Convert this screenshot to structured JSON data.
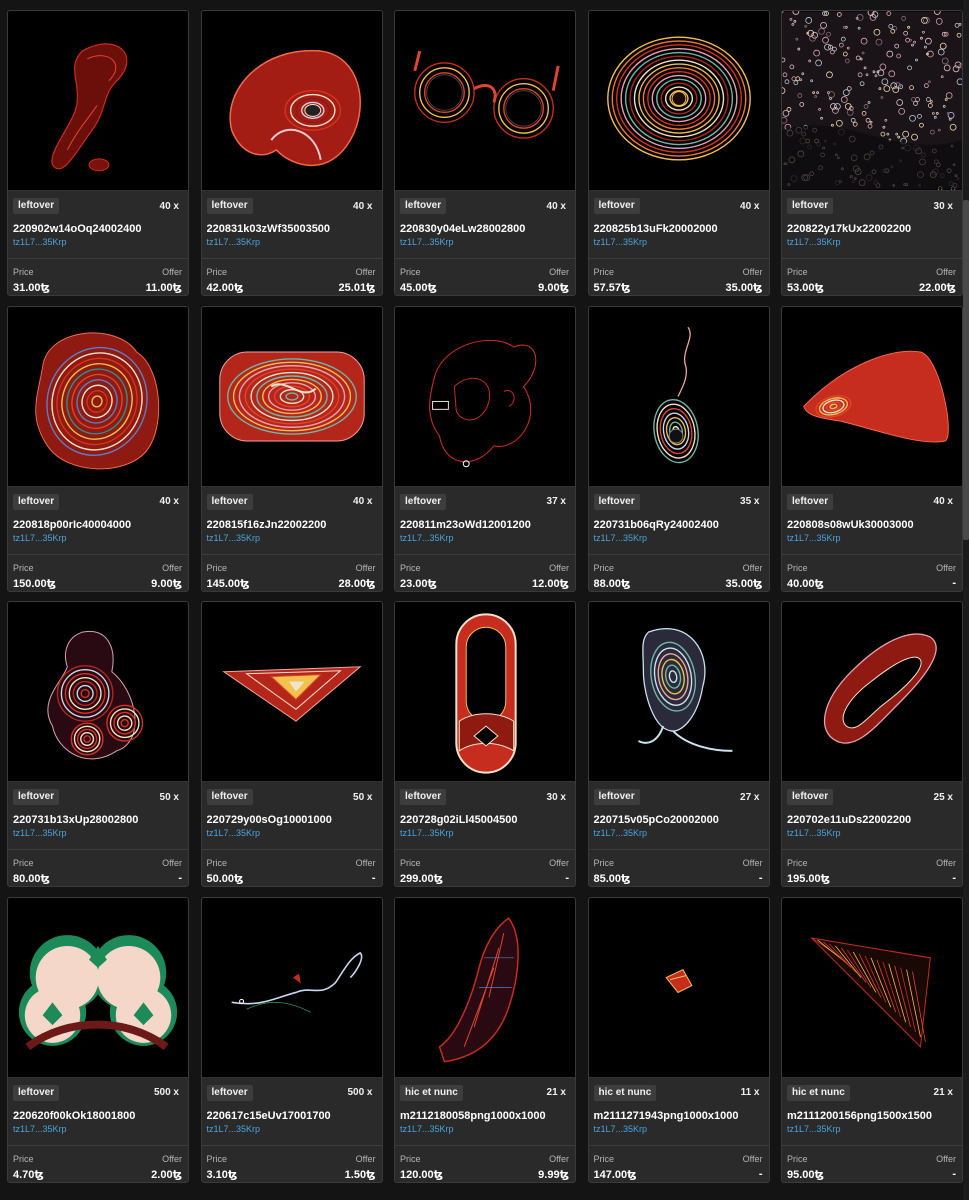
{
  "currency_symbol": "ꜩ",
  "labels": {
    "price": "Price",
    "offer": "Offer"
  },
  "colors": {
    "background": "#141414",
    "card": "#2a2a2a",
    "creator_link": "#4aa3df"
  },
  "cards": [
    {
      "platform": "leftover",
      "editions": "40 x",
      "title": "220902w14oOq24002400",
      "creator": "tz1L7...35Krp",
      "price": "31.00ꜩ",
      "offer": "11.00ꜩ",
      "art": "red-figure"
    },
    {
      "platform": "leftover",
      "editions": "40 x",
      "title": "220831k03zWf35003500",
      "creator": "tz1L7...35Krp",
      "price": "42.00ꜩ",
      "offer": "25.01ꜩ",
      "art": "red-head-shape"
    },
    {
      "platform": "leftover",
      "editions": "40 x",
      "title": "220830y04eLw28002800",
      "creator": "tz1L7...35Krp",
      "price": "45.00ꜩ",
      "offer": "9.00ꜩ",
      "art": "glasses-shape"
    },
    {
      "platform": "leftover",
      "editions": "40 x",
      "title": "220825b13uFk20002000",
      "creator": "tz1L7...35Krp",
      "price": "57.57ꜩ",
      "offer": "35.00ꜩ",
      "art": "concentric-disc"
    },
    {
      "platform": "leftover",
      "editions": "30 x",
      "title": "220822y17kUx22002200",
      "creator": "tz1L7...35Krp",
      "price": "53.00ꜩ",
      "offer": "22.00ꜩ",
      "art": "speckle-field"
    },
    {
      "platform": "leftover",
      "editions": "40 x",
      "title": "220818p00rIc40004000",
      "creator": "tz1L7...35Krp",
      "price": "150.00ꜩ",
      "offer": "9.00ꜩ",
      "art": "multicolor-blob"
    },
    {
      "platform": "leftover",
      "editions": "40 x",
      "title": "220815f16zJn22002200",
      "creator": "tz1L7...35Krp",
      "price": "145.00ꜩ",
      "offer": "28.00ꜩ",
      "art": "rounded-rect"
    },
    {
      "platform": "leftover",
      "editions": "37 x",
      "title": "220811m23oWd12001200",
      "creator": "tz1L7...35Krp",
      "price": "23.00ꜩ",
      "offer": "12.00ꜩ",
      "art": "red-outline"
    },
    {
      "platform": "leftover",
      "editions": "35 x",
      "title": "220731b06qRy24002400",
      "creator": "tz1L7...35Krp",
      "price": "88.00ꜩ",
      "offer": "35.00ꜩ",
      "art": "ear-shape"
    },
    {
      "platform": "leftover",
      "editions": "40 x",
      "title": "220808s08wUk30003000",
      "creator": "tz1L7...35Krp",
      "price": "40.00ꜩ",
      "offer": "-",
      "art": "red-triangle"
    },
    {
      "platform": "leftover",
      "editions": "50 x",
      "title": "220731b13xUp28002800",
      "creator": "tz1L7...35Krp",
      "price": "80.00ꜩ",
      "offer": "-",
      "art": "circles-cluster"
    },
    {
      "platform": "leftover",
      "editions": "50 x",
      "title": "220729y00sOg10001000",
      "creator": "tz1L7...35Krp",
      "price": "50.00ꜩ",
      "offer": "-",
      "art": "flat-triangle"
    },
    {
      "platform": "leftover",
      "editions": "30 x",
      "title": "220728g02iLl45004500",
      "creator": "tz1L7...35Krp",
      "price": "299.00ꜩ",
      "offer": "-",
      "art": "capsule"
    },
    {
      "platform": "leftover",
      "editions": "27 x",
      "title": "220715v05pCo20002000",
      "creator": "tz1L7...35Krp",
      "price": "85.00ꜩ",
      "offer": "-",
      "art": "light-teardrop"
    },
    {
      "platform": "leftover",
      "editions": "25 x",
      "title": "220702e11uDs22002200",
      "creator": "tz1L7...35Krp",
      "price": "195.00ꜩ",
      "offer": "-",
      "art": "diagonal-capsule"
    },
    {
      "platform": "leftover",
      "editions": "500 x",
      "title": "220620f00kOk18001800",
      "creator": "tz1L7...35Krp",
      "price": "4.70ꜩ",
      "offer": "2.00ꜩ",
      "art": "tri-lobe"
    },
    {
      "platform": "leftover",
      "editions": "500 x",
      "title": "220617c15eUv17001700",
      "creator": "tz1L7...35Krp",
      "price": "3.10ꜩ",
      "offer": "1.50ꜩ",
      "art": "wire-line"
    },
    {
      "platform": "hic et nunc",
      "editions": "21 x",
      "title": "m2112180058png1000x1000",
      "creator": "tz1L7...35Krp",
      "price": "120.00ꜩ",
      "offer": "9.99ꜩ",
      "art": "red-boot"
    },
    {
      "platform": "hic et nunc",
      "editions": "11 x",
      "title": "m2111271943png1000x1000",
      "creator": "tz1L7...35Krp",
      "price": "147.00ꜩ",
      "offer": "-",
      "art": "small-patch"
    },
    {
      "platform": "hic et nunc",
      "editions": "21 x",
      "title": "m2111200156png1500x1500",
      "creator": "tz1L7...35Krp",
      "price": "95.00ꜩ",
      "offer": "-",
      "art": "triangle-hatch"
    }
  ]
}
